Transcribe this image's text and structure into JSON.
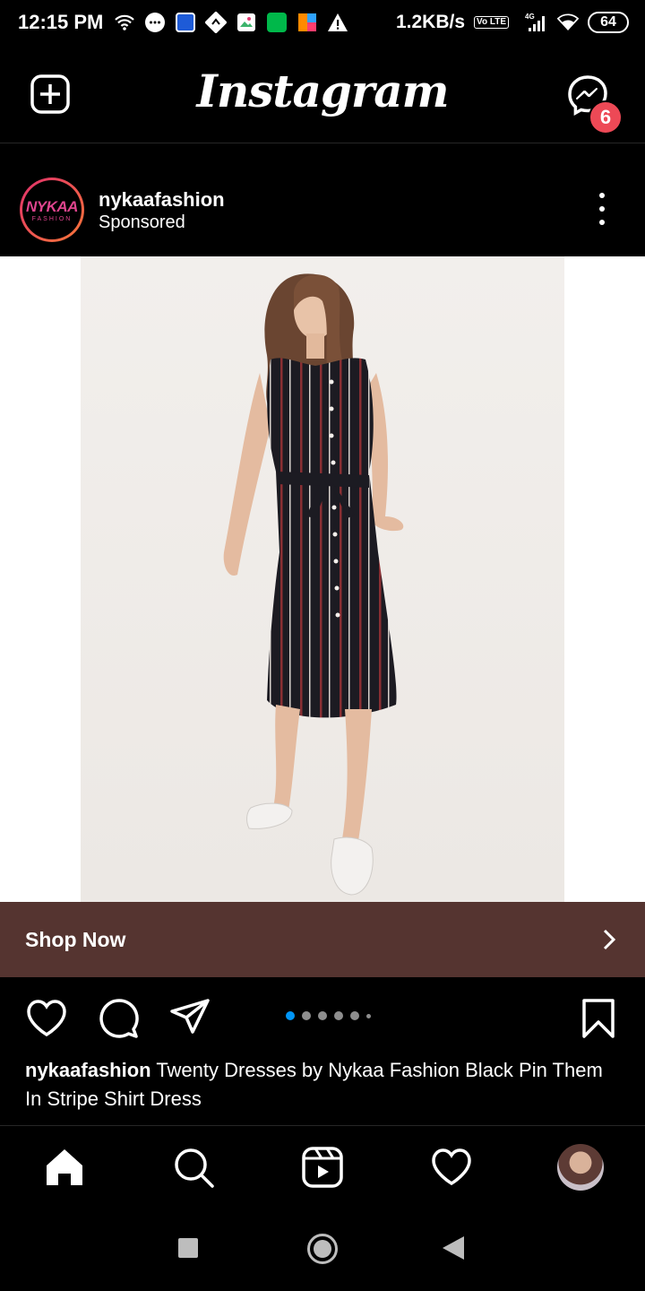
{
  "status_bar": {
    "time": "12:15 PM",
    "net_speed": "1.2KB/s",
    "volte": "Vo LTE",
    "network": "4G",
    "battery": "64"
  },
  "header": {
    "logo": "Instagram",
    "messenger_badge": "6"
  },
  "post": {
    "username": "nykaafashion",
    "sponsored": "Sponsored",
    "avatar_text": "NYKAA",
    "avatar_subtext": "FASHION",
    "cta_label": "Shop Now",
    "carousel_count": 6,
    "carousel_active": 0,
    "caption_user": "nykaafashion",
    "caption_text": " Twenty Dresses by Nykaa Fashion Black Pin Them In Stripe Shirt Dress"
  },
  "colors": {
    "cta_bg": "#553430",
    "badge": "#ed4956",
    "carousel_active": "#0095f6",
    "dress": "#1c1b22",
    "stripe_red": "#8a2f33"
  },
  "icons": {
    "new_post": "plus-square-icon",
    "messenger": "messenger-icon",
    "more": "more-vertical-icon",
    "like": "heart-icon",
    "comment": "comment-icon",
    "share": "send-icon",
    "save": "bookmark-icon",
    "home": "home-icon",
    "search": "search-icon",
    "reels": "reels-icon",
    "activity": "heart-icon",
    "profile": "profile-avatar"
  }
}
